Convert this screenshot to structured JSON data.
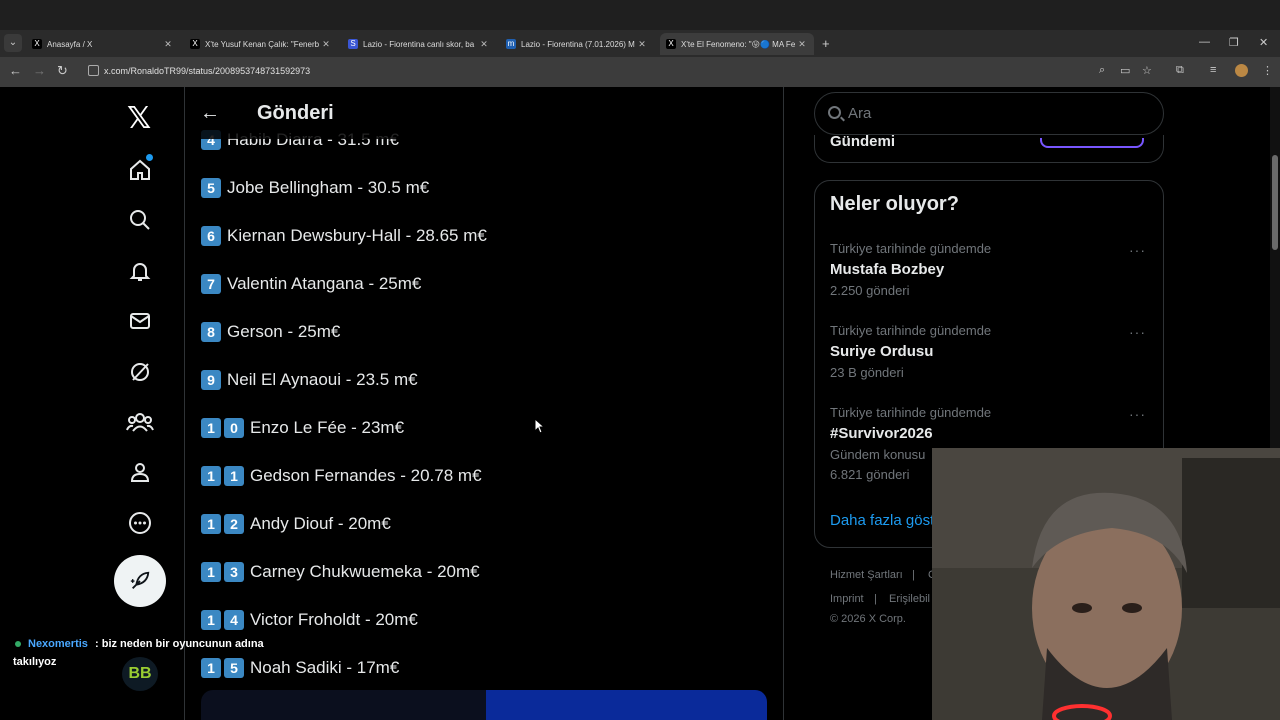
{
  "browser": {
    "tabs": [
      {
        "title": "Anasayfa / X",
        "favicon": "X",
        "active": false
      },
      {
        "title": "X'te Yusuf Kenan Çalık: \"Fenerb",
        "favicon": "X",
        "active": false
      },
      {
        "title": "Lazio - Fiorentina canlı skor, ba",
        "favicon": "S",
        "active": false
      },
      {
        "title": "Lazio - Fiorentina (7.01.2026) M",
        "favicon": "m",
        "active": false
      },
      {
        "title": "X'te El Fenomeno: \"😛🔵 MA Fe",
        "favicon": "X",
        "active": true
      }
    ],
    "url": "x.com/RonaldoTR99/status/2008953748731592973",
    "new_tab_symbol": "+"
  },
  "x_nav": {
    "items": [
      "home-icon",
      "search-icon",
      "notifications-icon",
      "messages-icon",
      "grok-icon",
      "communities-icon",
      "profile-icon",
      "more-icon"
    ]
  },
  "header": {
    "title": "Gönderi",
    "back_symbol": "←"
  },
  "post_list": [
    {
      "digits": [
        "4"
      ],
      "text": "Habib Diarra - 31.5 m€"
    },
    {
      "digits": [
        "5"
      ],
      "text": "Jobe Bellingham - 30.5 m€"
    },
    {
      "digits": [
        "6"
      ],
      "text": "Kiernan Dewsbury-Hall - 28.65 m€"
    },
    {
      "digits": [
        "7"
      ],
      "text": "Valentin Atangana - 25m€"
    },
    {
      "digits": [
        "8"
      ],
      "text": "Gerson - 25m€"
    },
    {
      "digits": [
        "9"
      ],
      "text": "Neil El Aynaoui - 23.5 m€"
    },
    {
      "digits": [
        "1",
        "0"
      ],
      "text": "Enzo Le Fée - 23m€"
    },
    {
      "digits": [
        "1",
        "1"
      ],
      "text": "Gedson Fernandes - 20.78 m€"
    },
    {
      "digits": [
        "1",
        "2"
      ],
      "text": "Andy Diouf - 20m€"
    },
    {
      "digits": [
        "1",
        "3"
      ],
      "text": "Carney Chukwuemeka - 20m€"
    },
    {
      "digits": [
        "1",
        "4"
      ],
      "text": "Victor Froholdt - 20m€"
    },
    {
      "digits": [
        "1",
        "5"
      ],
      "text": "Noah Sadiki - 17m€"
    }
  ],
  "sidebar": {
    "search_placeholder": "Ara",
    "prev_card_title": "Gündemi",
    "trends_heading": "Neler oluyor?",
    "trends": [
      {
        "category": "Türkiye tarihinde gündemde",
        "name": "Mustafa Bozbey",
        "count": "2.250 gönderi"
      },
      {
        "category": "Türkiye tarihinde gündemde",
        "name": "Suriye Ordusu",
        "count": "23 B gönderi"
      },
      {
        "category": "Türkiye tarihinde gündemde",
        "name": "#Survivor2026",
        "subcat": "Gündem konusu",
        "count": "6.821 gönderi"
      }
    ],
    "more_symbol": "···",
    "show_more": "Daha fazla göst",
    "footer": [
      "Hizmet Şartları",
      "|",
      "G",
      "Imprint",
      "|",
      "Erişilebil",
      "© 2026 X Corp."
    ]
  },
  "chat": {
    "user": "Nexomertis",
    "message": ": biz neden bir oyuncunun adına",
    "message_cont": "takılıyoz",
    "logo": "BB"
  },
  "colors": {
    "accent": "#1d9bf0",
    "keycap": "#3b88c3",
    "background": "#000000"
  }
}
